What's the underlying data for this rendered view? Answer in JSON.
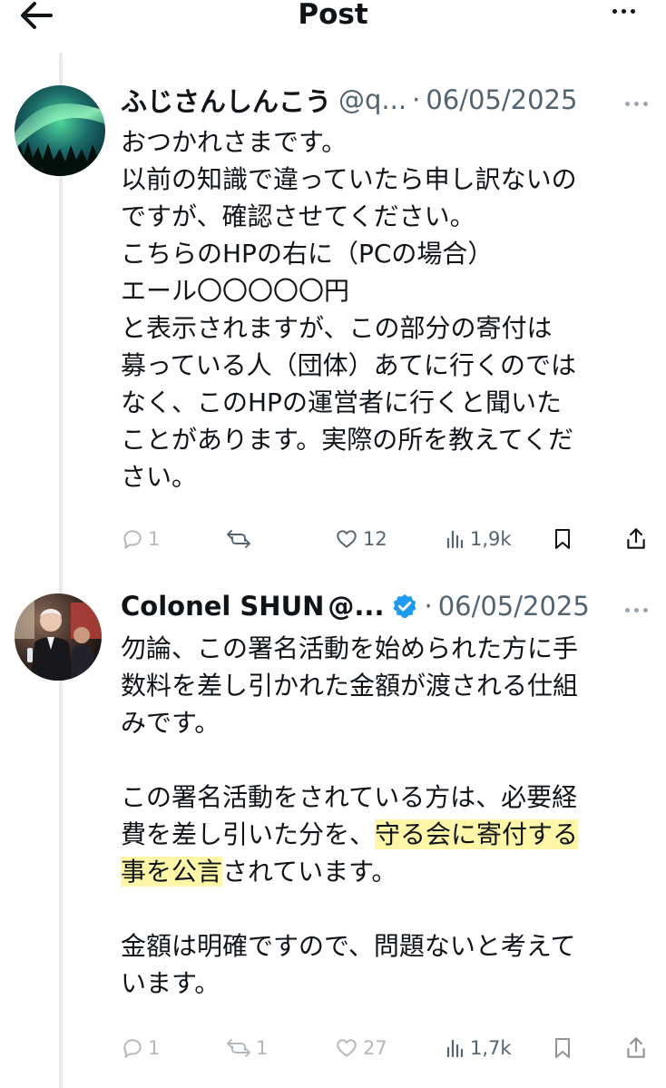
{
  "header": {
    "title": "Post"
  },
  "posts": [
    {
      "name": "ふじさんしんこう",
      "handle": "@q...",
      "separator": "·",
      "date": "06/05/2025",
      "verified": false,
      "lines": [
        "おつかれさまです。",
        "以前の知識で違っていたら申し訳ないの",
        "ですが、確認させてください。",
        "こちらのHPの右に（PCの場合）",
        "エール〇〇〇〇〇円",
        "と表示されますが、この部分の寄付は",
        "募っている人（団体）あてに行くのでは",
        "なく、このHPの運営者に行くと聞いた",
        "ことがあります。実際の所を教えてくだ",
        "さい。"
      ],
      "stats": {
        "replies": "1",
        "reposts": "",
        "likes": "12",
        "views": "1,9k"
      }
    },
    {
      "name": "Colonel SHUN",
      "handle": "@...",
      "separator": "·",
      "date": "06/05/2025",
      "verified": true,
      "lines": [
        "勿論、この署名活動を始められた方に手",
        "数料を差し引かれた金額が渡される仕組",
        "みです。",
        "",
        "この署名活動をされている方は、必要経",
        {
          "before": "費を差し引いた分を、",
          "highlight": "守る会に寄付する",
          "after": ""
        },
        {
          "before": "",
          "highlight": "事を公言",
          "after": "されています。"
        },
        "",
        "金額は明確ですので、問題ないと考えて",
        "います。"
      ],
      "stats": {
        "replies": "1",
        "reposts": "1",
        "likes": "27",
        "views": "1,7k"
      }
    }
  ],
  "icons": {
    "back": "arrow-left-icon",
    "more": "more-horizontal-icon",
    "reply": "reply-icon",
    "repost": "repost-icon",
    "like": "heart-icon",
    "views": "views-chart-icon",
    "bookmark": "bookmark-icon",
    "share": "share-icon",
    "verified": "verified-badge-icon"
  },
  "colors": {
    "text": "#0f1419",
    "secondary": "#536471",
    "verified": "#1d9bf0",
    "highlight": "#fff6a8"
  }
}
